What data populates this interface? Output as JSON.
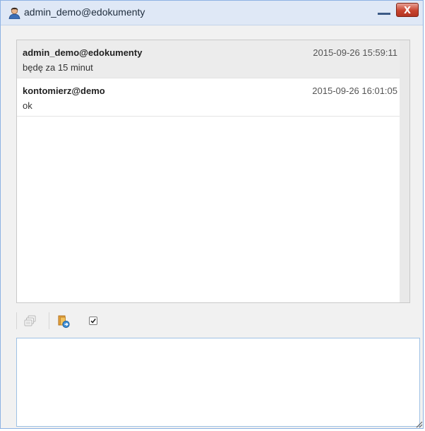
{
  "window": {
    "title": "admin_demo@edokumenty",
    "icons": [
      "user-avatar-icon",
      "minimize-icon",
      "close-icon"
    ],
    "close_label": "X"
  },
  "messages": [
    {
      "from": "admin_demo@edokumenty",
      "time": "2015-09-26 15:59:11",
      "text": "będę za 15 minut"
    },
    {
      "from": "kontomierz@demo",
      "time": "2015-09-26 16:01:05",
      "text": "ok"
    }
  ],
  "toolbar": {
    "icons": [
      "copy-icon",
      "attach-file-icon",
      "checkbox-icon"
    ],
    "checkbox_checked": true
  },
  "compose": {
    "value": "",
    "placeholder": ""
  },
  "colors": {
    "titlebar": "#dfe8f6",
    "window_border": "#8db2e3",
    "close_button": "#c8442f",
    "selected_row": "#ececec"
  }
}
